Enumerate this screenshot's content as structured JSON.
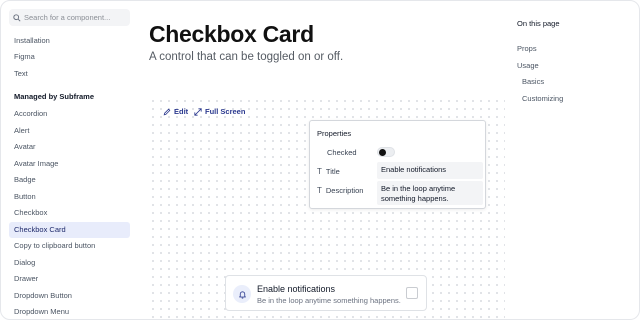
{
  "search": {
    "placeholder": "Search for a component..."
  },
  "sidebar": {
    "top_items": [
      "Installation",
      "Figma",
      "Text"
    ],
    "section_heading": "Managed by Subframe",
    "items": [
      "Accordion",
      "Alert",
      "Avatar",
      "Avatar Image",
      "Badge",
      "Button",
      "Checkbox",
      "Checkbox Card",
      "Copy to clipboard button",
      "Dialog",
      "Drawer",
      "Dropdown Button",
      "Dropdown Menu"
    ],
    "active_item": "Checkbox Card"
  },
  "main": {
    "title": "Checkbox Card",
    "subtitle": "A control that can be toggled on or off."
  },
  "toolbar": {
    "edit_label": "Edit",
    "fullscreen_label": "Full Screen"
  },
  "properties": {
    "title": "Properties",
    "checked_label": "Checked",
    "checked_value": true,
    "title_label": "Title",
    "title_value": "Enable notifications",
    "description_label": "Description",
    "description_value": "Be in the loop anytime something happens."
  },
  "demo_card": {
    "icon": "bell-icon",
    "title": "Enable notifications",
    "description": "Be in the loop anytime something happens.",
    "checked": false
  },
  "toc": {
    "title": "On this page",
    "items": [
      "Props",
      "Usage",
      "Basics",
      "Customizing"
    ]
  },
  "colors": {
    "accent": "#2c3a8f",
    "active_bg": "#e8ecfb",
    "bell_bg": "#eaeefb"
  }
}
